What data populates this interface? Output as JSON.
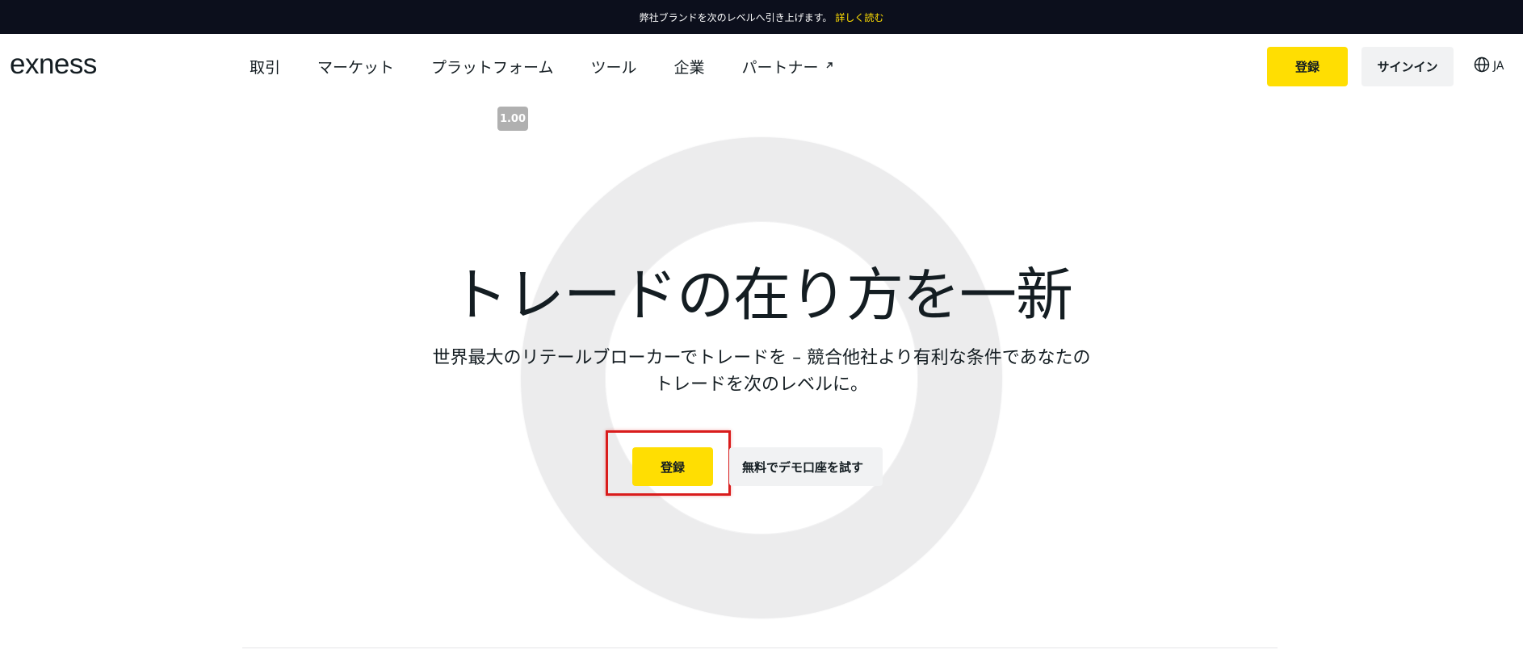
{
  "banner": {
    "text": "弊社ブランドを次のレベルへ引き上げます。",
    "link": "詳しく読む"
  },
  "header": {
    "logo": "exness",
    "nav": [
      {
        "label": "取引"
      },
      {
        "label": "マーケット"
      },
      {
        "label": "プラットフォーム"
      },
      {
        "label": "ツール"
      },
      {
        "label": "企業"
      },
      {
        "label": "パートナー",
        "icon": "external-arrow-icon"
      }
    ],
    "register_label": "登録",
    "signin_label": "サインイン",
    "language": "JA"
  },
  "hero": {
    "badge": "1.00",
    "title": "トレードの在り方を一新",
    "subtitle": "世界最大のリテールブローカーでトレードを – 競合他社より有利な条件であなたのトレードを次のレベルに。",
    "register_label": "登録",
    "demo_label": "無料でデモ口座を試す"
  },
  "colors": {
    "accent": "#ffde02",
    "banner_bg": "#0c0f1c",
    "banner_link": "#ffde02",
    "highlight": "#d91c1c",
    "text": "#141d22"
  }
}
